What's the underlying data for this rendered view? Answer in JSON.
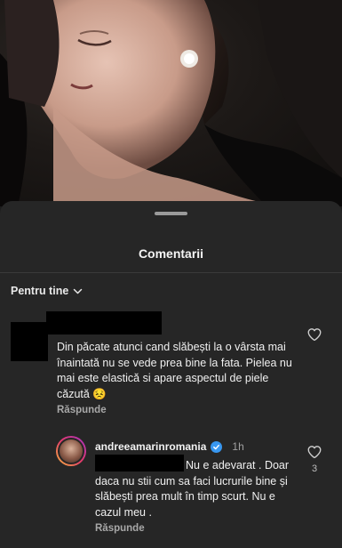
{
  "sheet": {
    "title": "Comentarii",
    "filter_label": "Pentru tine"
  },
  "comment": {
    "text": "Din păcate atunci cand slăbești la o vârsta mai înaintată nu se vede prea bine la fata. Pielea nu mai este elastică si apare aspectul de piele căzută 😣",
    "reply_label": "Răspunde"
  },
  "reply": {
    "username": "andreeamarinromania",
    "time": "1h",
    "text": "Nu e adevarat . Doar daca nu stii cum sa faci lucrurile bine și slăbești prea mult în timp scurt. Nu e cazul meu .",
    "reply_label": "Răspunde",
    "like_count": "3"
  },
  "icons": {
    "like": "heart-outline-icon",
    "filter": "chevron-down-icon",
    "verified": "verified-badge-icon"
  },
  "colors": {
    "sheet_bg": "#262626",
    "verified": "#3897f0",
    "muted_text": "#a8a8a8"
  }
}
